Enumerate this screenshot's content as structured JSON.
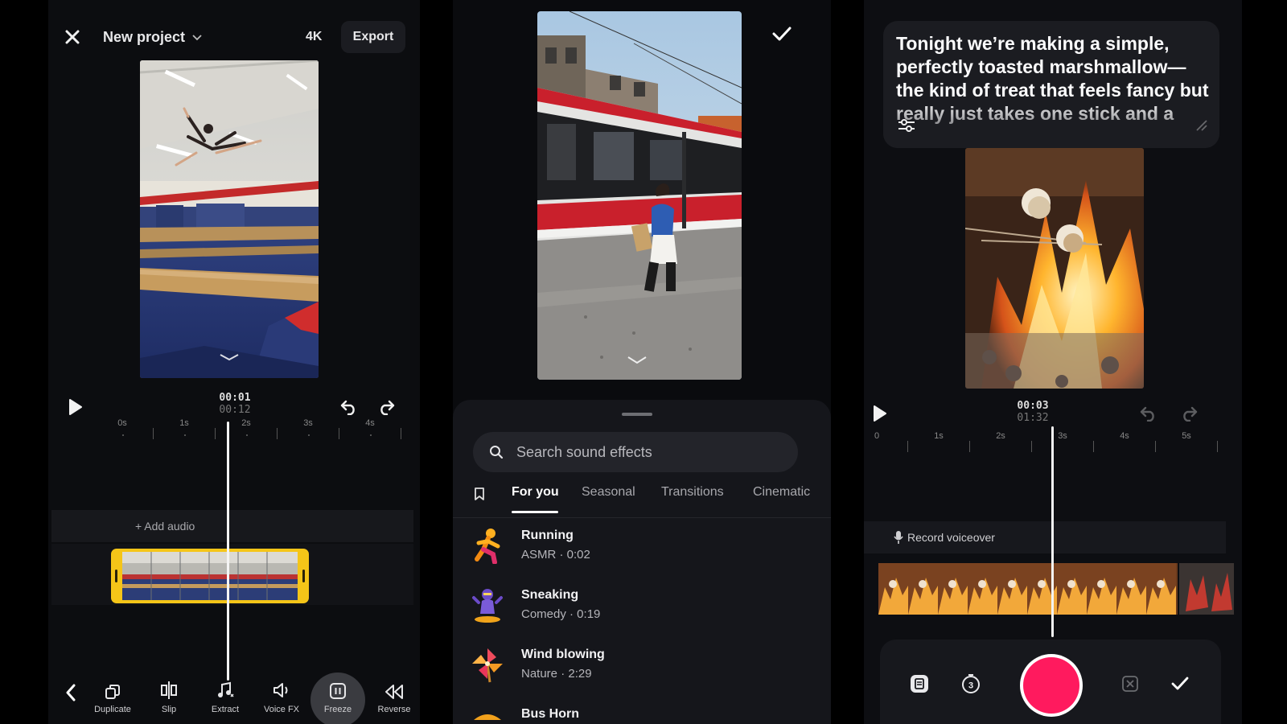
{
  "editor": {
    "close_icon": "close-icon",
    "project_title": "New project",
    "resolution": "4K",
    "export_label": "Export",
    "time_current": "00:01",
    "time_total": "00:12",
    "ruler_labels": [
      "0s",
      "1s",
      "2s",
      "3s",
      "4s"
    ],
    "add_audio_label": "+ Add audio",
    "toolbar": [
      {
        "label": "Duplicate",
        "icon": "duplicate-icon"
      },
      {
        "label": "Slip",
        "icon": "slip-icon"
      },
      {
        "label": "Extract",
        "icon": "extract-audio-icon"
      },
      {
        "label": "Voice FX",
        "icon": "voice-fx-icon"
      },
      {
        "label": "Freeze",
        "icon": "freeze-icon"
      },
      {
        "label": "Reverse",
        "icon": "reverse-icon"
      }
    ]
  },
  "sound_effects": {
    "search_placeholder": "Search sound effects",
    "tabs": [
      "For you",
      "Seasonal",
      "Transitions",
      "Cinematic"
    ],
    "active_tab": "For you",
    "items": [
      {
        "name": "Running",
        "meta": "ASMR · 0:02",
        "icon": "running-figure-icon"
      },
      {
        "name": "Sneaking",
        "meta": "Comedy · 0:19",
        "icon": "sneaking-figure-icon"
      },
      {
        "name": "Wind blowing",
        "meta": "Nature · 2:29",
        "icon": "pinwheel-icon"
      },
      {
        "name": "Bus Horn",
        "meta": "",
        "icon": "bus-icon"
      }
    ]
  },
  "voiceover": {
    "caption_text": "Tonight we’re making a simple, perfectly toasted marshmallow—the kind of treat that feels fancy but really just takes one stick and a",
    "time_current": "00:03",
    "time_total": "01:32",
    "ruler_labels": [
      "0",
      "1s",
      "2s",
      "3s",
      "4s",
      "5s"
    ],
    "record_voiceover_label": "Record voiceover",
    "record_color": "#ff1a5e"
  },
  "colors": {
    "clip_selection": "#f5c518",
    "background": "#0d0e12"
  }
}
